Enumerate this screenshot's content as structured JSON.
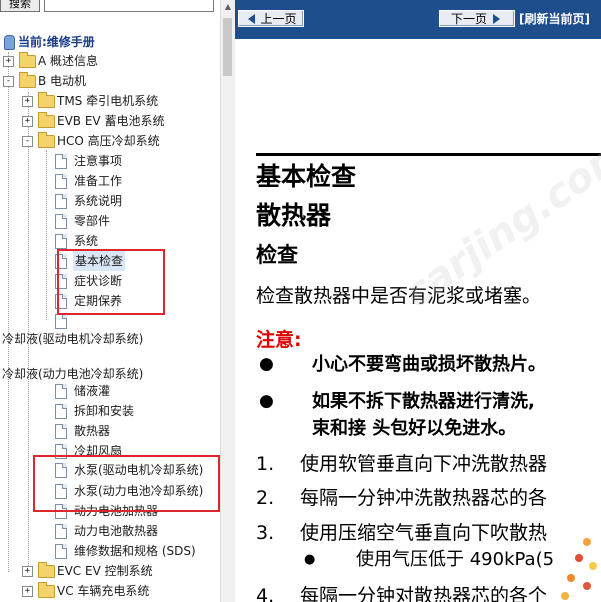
{
  "colors": {
    "nav_blue": "#1f4e8c",
    "caution_red": "#e00000",
    "annotation_red": "#e0262d"
  },
  "toolbar": {
    "search_label": "搜索",
    "search_value": ""
  },
  "tree": {
    "root_label": "当前:维修手册",
    "items": [
      {
        "label": "A 概述信息"
      },
      {
        "label": "B 电动机"
      },
      {
        "label": "TMS 牵引电机系统"
      },
      {
        "label": "EVB EV 蓄电池系统"
      },
      {
        "label": "HCO 高压冷却系统"
      },
      {
        "label": "注意事项"
      },
      {
        "label": "准备工作"
      },
      {
        "label": "系统说明"
      },
      {
        "label": "零部件"
      },
      {
        "label": "系统"
      },
      {
        "label": "基本检查"
      },
      {
        "label": "症状诊断"
      },
      {
        "label": "定期保养"
      },
      {
        "label": ""
      },
      {
        "label": "冷却液(驱动电机冷却系统)"
      },
      {
        "label": "冷却液(动力电池冷却系统)"
      },
      {
        "label": "储液灌"
      },
      {
        "label": "拆卸和安装"
      },
      {
        "label": "散热器"
      },
      {
        "label": "冷却风扇"
      },
      {
        "label": "水泵(驱动电机冷却系统)"
      },
      {
        "label": "水泵(动力电池冷却系统)"
      },
      {
        "label": "动力电池加热器"
      },
      {
        "label": "动力电池散热器"
      },
      {
        "label": "维修数据和规格 (SDS)"
      },
      {
        "label": "EVC EV 控制系统"
      },
      {
        "label": "VC 车辆充电系统"
      }
    ]
  },
  "nav": {
    "prev_label": "上一页",
    "next_label": "下一页",
    "refresh_label": "[刷新当前页]"
  },
  "content": {
    "title1": "基本检查",
    "title2": "散热器",
    "section_heading": "检查",
    "paragraph": "检查散热器中是否有泥浆或堵塞。",
    "caution_label": "注意:",
    "bullets": [
      {
        "mark": "●",
        "line1": "小心不要弯曲或损坏散热片。",
        "line2": ""
      },
      {
        "mark": "●",
        "line1": "如果不拆下散热器进行清洗,",
        "line2": "束和接 头包好以免进水。"
      }
    ],
    "steps": [
      {
        "num": "1.",
        "text": "使用软管垂直向下冲洗散热器"
      },
      {
        "num": "2.",
        "text": "每隔一分钟冲洗散热器芯的各"
      },
      {
        "num": "3.",
        "text": "使用压缩空气垂直向下吹散热"
      },
      {
        "num": "4.",
        "text": "每隔一分钟对散热器芯的各个"
      }
    ],
    "sub_bullet": {
      "mark": "●",
      "text": "使用气压低于 490kPa(5"
    }
  },
  "watermark": "carjing.com"
}
